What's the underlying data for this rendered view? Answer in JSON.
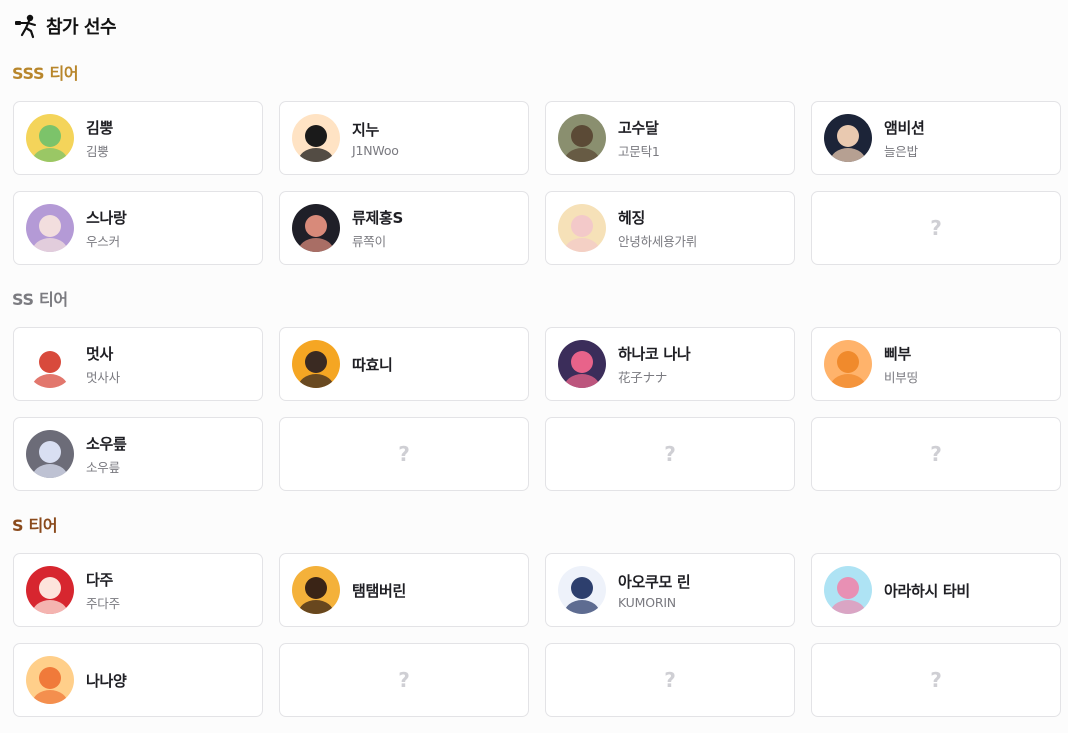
{
  "page": {
    "title": "참가 선수",
    "header_icon": "player-figure-icon"
  },
  "tiers": [
    {
      "title": "SSS 티어",
      "color": "#b8862b",
      "cards": [
        {
          "name": "김뿡",
          "sub": "김뿡",
          "avatar_bg": "#f4d45a",
          "avatar_fg": "#7cc36a"
        },
        {
          "name": "지누",
          "sub": "J1NWoo",
          "avatar_bg": "#ffe3c4",
          "avatar_fg": "#1a1a1a"
        },
        {
          "name": "고수달",
          "sub": "고문탁1",
          "avatar_bg": "#8a8f6f",
          "avatar_fg": "#5b4a36"
        },
        {
          "name": "앰비션",
          "sub": "늘은밥",
          "avatar_bg": "#1c2438",
          "avatar_fg": "#e9c9b0"
        },
        {
          "name": "스나랑",
          "sub": "우스커",
          "avatar_bg": "#b49ad6",
          "avatar_fg": "#f2dede"
        },
        {
          "name": "류제홍S",
          "sub": "류쪽이",
          "avatar_bg": "#1f1f28",
          "avatar_fg": "#d88a7a"
        },
        {
          "name": "헤징",
          "sub": "안녕하세용가뤼",
          "avatar_bg": "#f6e1b8",
          "avatar_fg": "#f3c9c9"
        },
        {
          "empty": true,
          "label": "?"
        }
      ]
    },
    {
      "title": "SS 티어",
      "color": "#7b7b80",
      "cards": [
        {
          "name": "멋사",
          "sub": "멋사사",
          "avatar_bg": "#ffffff",
          "avatar_fg": "#d84a3c"
        },
        {
          "name": "따효니",
          "sub": "",
          "avatar_bg": "#f5a623",
          "avatar_fg": "#3a2a22"
        },
        {
          "name": "하나코 나나",
          "sub": "花子ナナ",
          "avatar_bg": "#3b2d5a",
          "avatar_fg": "#e8638a"
        },
        {
          "name": "삐부",
          "sub": "비부띵",
          "avatar_bg": "#ffb36b",
          "avatar_fg": "#f08a2c"
        },
        {
          "name": "소우릎",
          "sub": "소우릎",
          "avatar_bg": "#6c6c78",
          "avatar_fg": "#d9dff2"
        },
        {
          "empty": true,
          "label": "?"
        },
        {
          "empty": true,
          "label": "?"
        },
        {
          "empty": true,
          "label": "?"
        }
      ]
    },
    {
      "title": "S 티어",
      "color": "#8a4a1c",
      "cards": [
        {
          "name": "다주",
          "sub": "주다주",
          "avatar_bg": "#d7262f",
          "avatar_fg": "#fde4dc"
        },
        {
          "name": "탬탬버린",
          "sub": "",
          "avatar_bg": "#f4b13a",
          "avatar_fg": "#3a2416"
        },
        {
          "name": "아오쿠모 린",
          "sub": "KUMORIN",
          "avatar_bg": "#eef2fa",
          "avatar_fg": "#2d3f6d"
        },
        {
          "name": "아라하시 타비",
          "sub": "",
          "avatar_bg": "#aee3f4",
          "avatar_fg": "#e890b4"
        },
        {
          "name": "나나양",
          "sub": "",
          "avatar_bg": "#ffcf8a",
          "avatar_fg": "#f07a3a"
        },
        {
          "empty": true,
          "label": "?"
        },
        {
          "empty": true,
          "label": "?"
        },
        {
          "empty": true,
          "label": "?"
        }
      ]
    }
  ]
}
